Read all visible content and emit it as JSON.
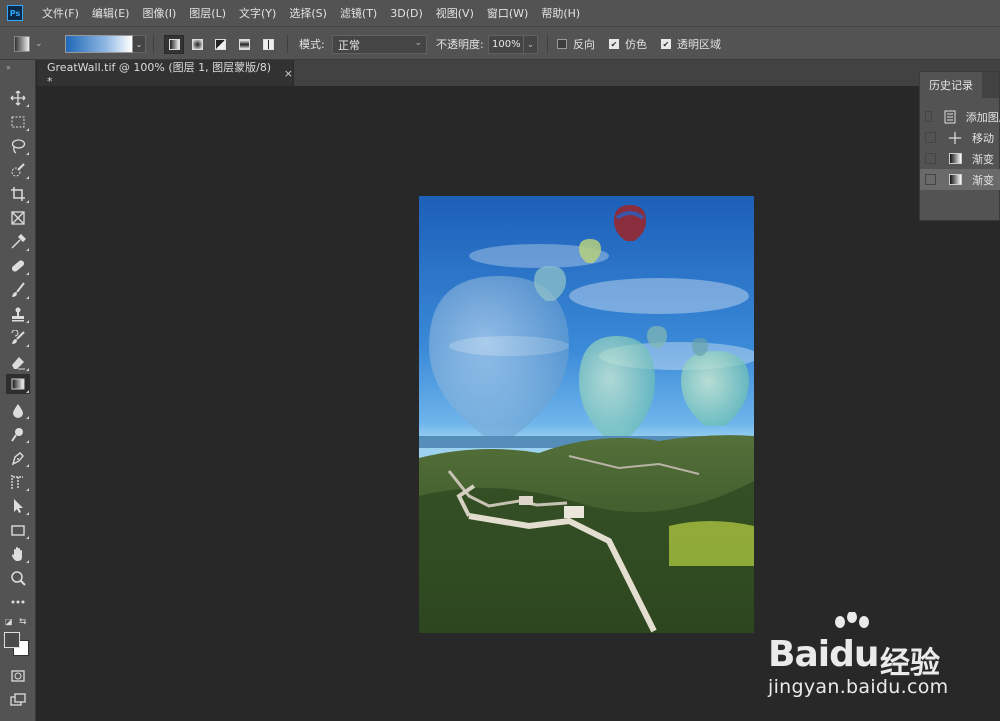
{
  "app": {
    "logo_text": "Ps"
  },
  "menu": [
    "文件(F)",
    "编辑(E)",
    "图像(I)",
    "图层(L)",
    "文字(Y)",
    "选择(S)",
    "滤镜(T)",
    "3D(D)",
    "视图(V)",
    "窗口(W)",
    "帮助(H)"
  ],
  "options": {
    "mode_label": "模式:",
    "mode_value": "正常",
    "opacity_label": "不透明度:",
    "opacity_value": "100%",
    "reverse_label": "反向",
    "reverse_checked": false,
    "dither_label": "仿色",
    "dither_checked": true,
    "transparency_label": "透明区域",
    "transparency_checked": true,
    "gradient_colors": [
      "#1f67b7",
      "#ffffff"
    ]
  },
  "document": {
    "tab_title": "GreatWall.tif @ 100% (图层 1, 图层蒙版/8) *",
    "close_glyph": "×"
  },
  "history": {
    "title": "历史记录",
    "items": [
      {
        "label": "添加图层蒙版",
        "icon": "document-icon",
        "selected": false
      },
      {
        "label": "移动",
        "icon": "move-icon",
        "selected": false
      },
      {
        "label": "渐变",
        "icon": "gradient-icon",
        "selected": false
      },
      {
        "label": "渐变",
        "icon": "gradient-icon",
        "selected": true
      }
    ]
  },
  "toolbar": {
    "tools": [
      "move-tool",
      "marquee-tool",
      "lasso-tool",
      "quick-selection-tool",
      "crop-tool",
      "frame-tool",
      "eyedropper-tool",
      "healing-brush-tool",
      "brush-tool",
      "clone-stamp-tool",
      "history-brush-tool",
      "eraser-tool",
      "gradient-tool",
      "blur-tool",
      "dodge-tool",
      "pen-tool",
      "type-tool",
      "path-selection-tool",
      "rectangle-tool",
      "hand-tool",
      "zoom-tool",
      "more-tools"
    ],
    "active_tool": "gradient-tool",
    "foreground_color": "#4a4a4a",
    "background_color": "#ffffff"
  },
  "watermark": {
    "brand": "Bai",
    "brand2": "du",
    "cn": "经验",
    "url": "jingyan.baidu.com"
  }
}
